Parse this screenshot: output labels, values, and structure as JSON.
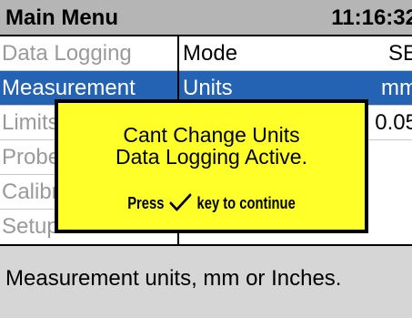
{
  "header": {
    "title": "Main Menu",
    "time": "11:16:32"
  },
  "menu": {
    "items": [
      {
        "label": "Data Logging",
        "selected": false
      },
      {
        "label": "Measurement",
        "selected": true
      },
      {
        "label": "Limits",
        "selected": false
      },
      {
        "label": "Probe",
        "selected": false
      },
      {
        "label": "Calibration",
        "selected": false
      },
      {
        "label": "Setup",
        "selected": false
      }
    ]
  },
  "params": {
    "rows": [
      {
        "label": "Mode",
        "value": "SE",
        "selected": false
      },
      {
        "label": "Units",
        "value": "mm",
        "selected": true
      },
      {
        "label": "",
        "value": "0.05",
        "selected": false
      }
    ]
  },
  "dialog": {
    "line1": "Cant Change Units",
    "line2": "Data Logging Active.",
    "hint_prefix": "Press",
    "hint_icon": "check-icon",
    "hint_suffix": "key to continue"
  },
  "status": {
    "text": "Measurement units, mm or Inches."
  }
}
